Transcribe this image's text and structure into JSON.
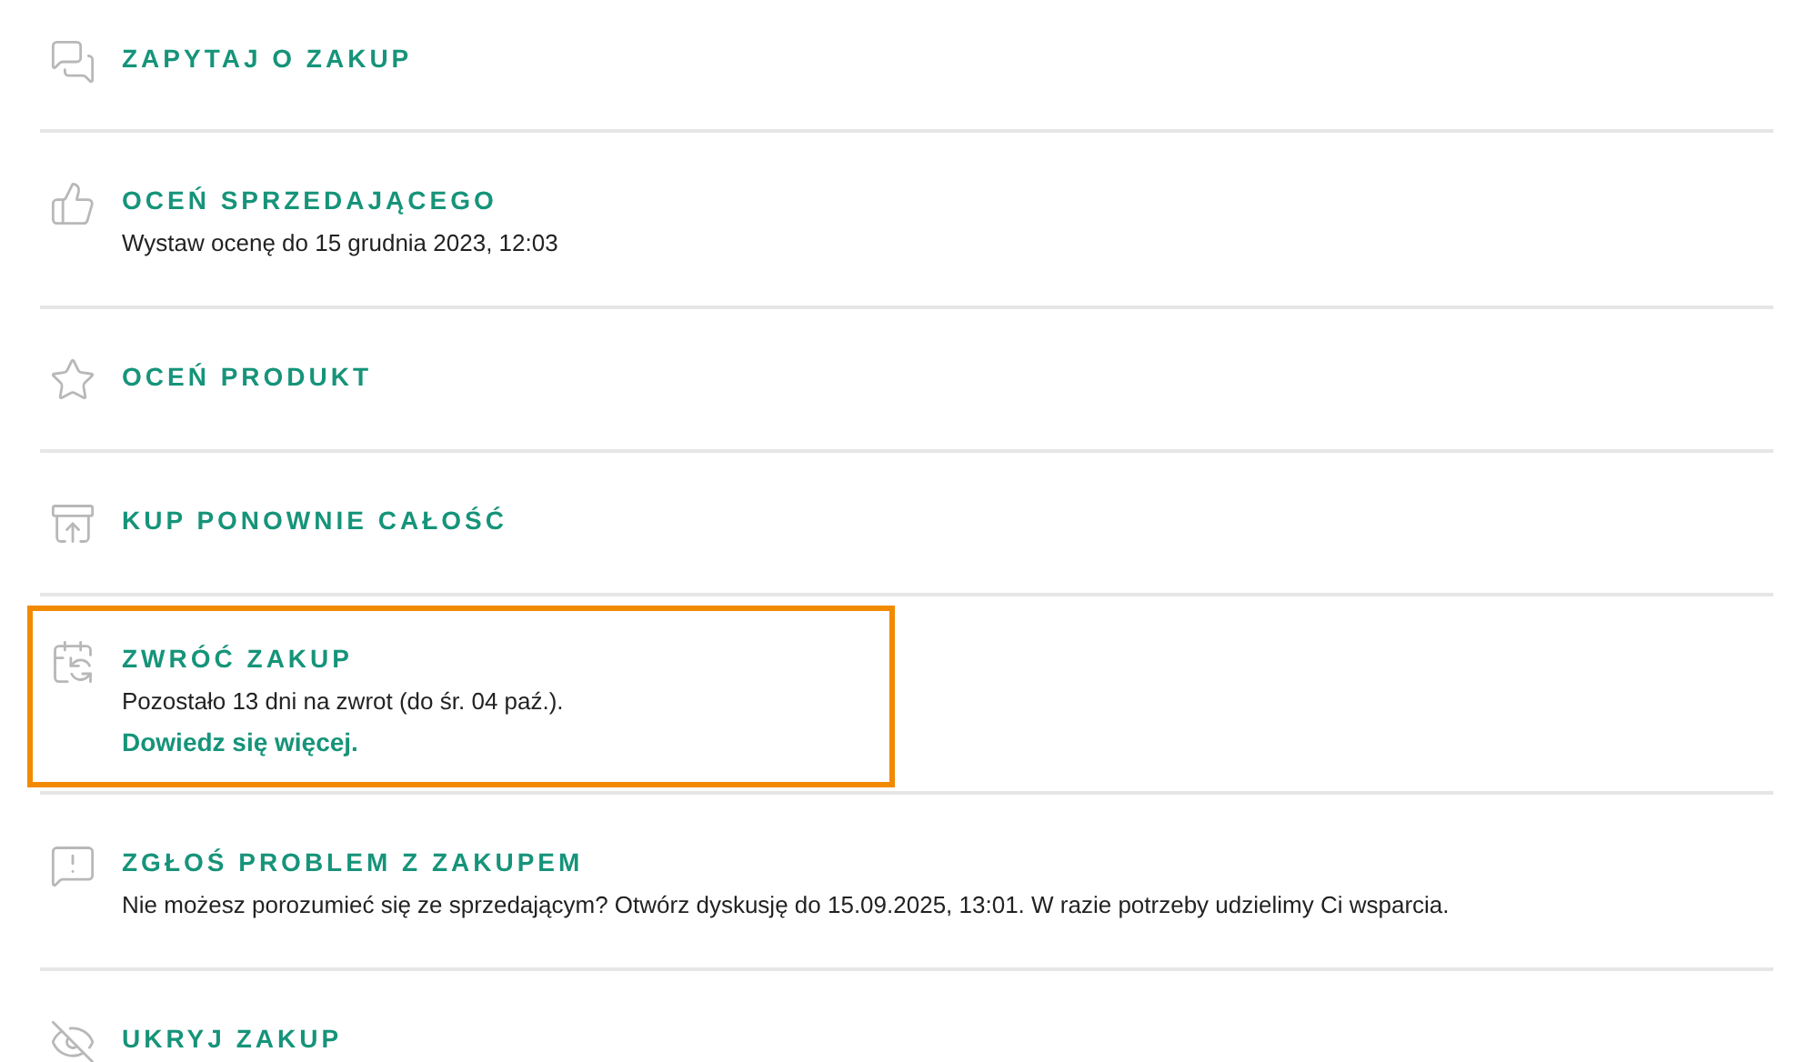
{
  "actions": [
    {
      "kind": "chat",
      "title": "ZAPYTAJ O ZAKUP",
      "highlighted": false
    },
    {
      "kind": "thumb",
      "title": "OCEŃ SPRZEDAJĄCEGO",
      "description": "Wystaw ocenę do 15 grudnia 2023, 12:03",
      "highlighted": false
    },
    {
      "kind": "star",
      "title": "OCEŃ PRODUKT",
      "highlighted": false
    },
    {
      "kind": "rebuy",
      "title": "KUP PONOWNIE CAŁOŚĆ",
      "highlighted": false
    },
    {
      "kind": "return",
      "title": "ZWRÓĆ ZAKUP",
      "description": "Pozostało 13 dni na zwrot (do śr. 04 paź.).",
      "link": "Dowiedz się więcej.",
      "highlighted": true
    },
    {
      "kind": "problem",
      "title": "ZGŁOŚ PROBLEM Z ZAKUPEM",
      "description": "Nie możesz porozumieć się ze sprzedającym? Otwórz dyskusję do 15.09.2025, 13:01. W razie potrzeby udzielimy Ci wsparcia.",
      "highlighted": false
    },
    {
      "kind": "hide",
      "title": "UKRYJ ZAKUP",
      "highlighted": false
    }
  ]
}
